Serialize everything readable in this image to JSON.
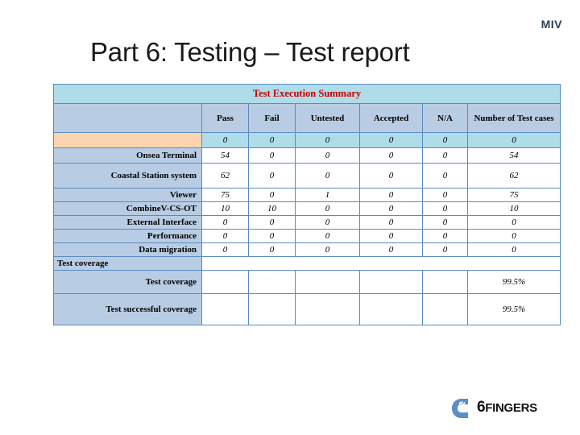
{
  "slide": {
    "brand": "MIV",
    "title": "Part 6: Testing – Test report"
  },
  "table": {
    "banner": "Test Execution Summary",
    "columns": [
      "",
      "Pass",
      "Fail",
      "Untested",
      "Accepted",
      "N/A",
      "Number of Test cases"
    ],
    "rows": [
      {
        "label": "",
        "style": "peach",
        "values": [
          "0",
          "0",
          "0",
          "0",
          "0",
          "0"
        ]
      },
      {
        "label": "Onsea Terminal",
        "style": "normal",
        "values": [
          "54",
          "0",
          "0",
          "0",
          "0",
          "54"
        ]
      },
      {
        "label": "Coastal Station system",
        "style": "tall",
        "values": [
          "62",
          "0",
          "0",
          "0",
          "0",
          "62"
        ]
      },
      {
        "label": "Viewer",
        "style": "normal",
        "values": [
          "75",
          "0",
          "1",
          "0",
          "0",
          "75"
        ]
      },
      {
        "label": "CombineV-CS-OT",
        "style": "normal",
        "values": [
          "10",
          "10",
          "0",
          "0",
          "0",
          "10"
        ]
      },
      {
        "label": "External Interface",
        "style": "normal",
        "values": [
          "0",
          "0",
          "0",
          "0",
          "0",
          "0"
        ]
      },
      {
        "label": "Performance",
        "style": "normal",
        "values": [
          "0",
          "0",
          "0",
          "0",
          "0",
          "0"
        ]
      },
      {
        "label": "Data migration",
        "style": "normal",
        "values": [
          "0",
          "0",
          "0",
          "0",
          "0",
          "0"
        ]
      }
    ],
    "section": {
      "label": "Test coverage"
    },
    "coverage_rows": [
      {
        "label": "Test coverage",
        "values": [
          "",
          "",
          "",
          "",
          "",
          "99.5%"
        ]
      },
      {
        "label": "Test successful coverage",
        "values": [
          "",
          "",
          "",
          "",
          "",
          "99.5%"
        ]
      }
    ]
  },
  "footer": {
    "logo_text_6": "6",
    "logo_text_fingers": "FINGERS"
  }
}
